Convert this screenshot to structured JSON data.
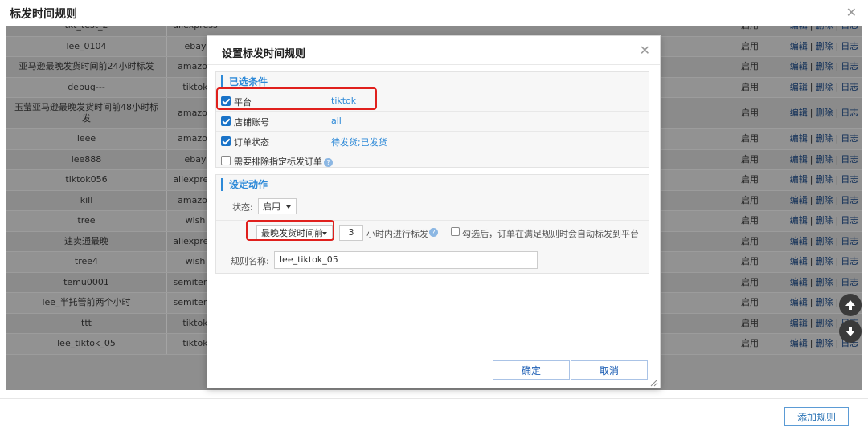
{
  "page": {
    "title": "标发时间规则"
  },
  "table": {
    "rows": [
      {
        "name": "tkt_test_2",
        "platform": "aliexpress",
        "status": "启用"
      },
      {
        "name": "lee_0104",
        "platform": "ebay",
        "status": "启用"
      },
      {
        "name": "亚马逊最晚发货时间前24小时标发",
        "platform": "amazon",
        "status": "启用"
      },
      {
        "name": "debug---",
        "platform": "tiktok",
        "status": "启用"
      },
      {
        "name": "玉莹亚马逊最晚发货时间前48小时标发",
        "platform": "amazon",
        "status": "启用",
        "tall": true
      },
      {
        "name": "leee",
        "platform": "amazon",
        "status": "启用"
      },
      {
        "name": "lee888",
        "platform": "ebay",
        "status": "启用"
      },
      {
        "name": "tiktok056",
        "platform": "aliexpress",
        "status": "启用"
      },
      {
        "name": "kill",
        "platform": "amazon",
        "status": "启用"
      },
      {
        "name": "tree",
        "platform": "wish",
        "status": "启用"
      },
      {
        "name": "速卖通最晚",
        "platform": "aliexpress",
        "status": "启用"
      },
      {
        "name": "tree4",
        "platform": "wish",
        "status": "启用"
      },
      {
        "name": "temu0001",
        "platform": "semitemu",
        "status": "启用"
      },
      {
        "name": "lee_半托管前两个小时",
        "platform": "semitemu",
        "status": "启用"
      },
      {
        "name": "ttt",
        "platform": "tiktok",
        "status": "启用"
      },
      {
        "name": "lee_tiktok_05",
        "platform": "tiktok",
        "status": "启用"
      }
    ],
    "ops": {
      "edit": "编辑",
      "delete": "删除",
      "log": "日志"
    }
  },
  "bottom": {
    "add_rule": "添加规则"
  },
  "modal": {
    "title": "设置标发时间规则",
    "selected_conditions": {
      "heading": "已选条件",
      "items": [
        {
          "label": "平台",
          "value": "tiktok",
          "checked": true
        },
        {
          "label": "店铺账号",
          "value": "all",
          "checked": true
        },
        {
          "label": "订单状态",
          "value": "待发货;已发货",
          "checked": true
        },
        {
          "label": "需要排除指定标发订单",
          "value": "",
          "checked": false
        }
      ]
    },
    "action": {
      "heading": "设定动作",
      "status_label": "状态:",
      "status_value": "启用",
      "time_select": "最晚发货时间前",
      "hours": "3",
      "hours_suffix": "小时内进行标发",
      "auto_check_label": "勾选后，订单在满足规则时会自动标发到平台",
      "rule_name_label": "规则名称:",
      "rule_name_value": "lee_tiktok_05"
    },
    "confirm": "确定",
    "cancel": "取消"
  },
  "colors": {
    "accent": "#2e8ad8",
    "highlight": "#e0201d",
    "link": "#1e5fb5"
  }
}
